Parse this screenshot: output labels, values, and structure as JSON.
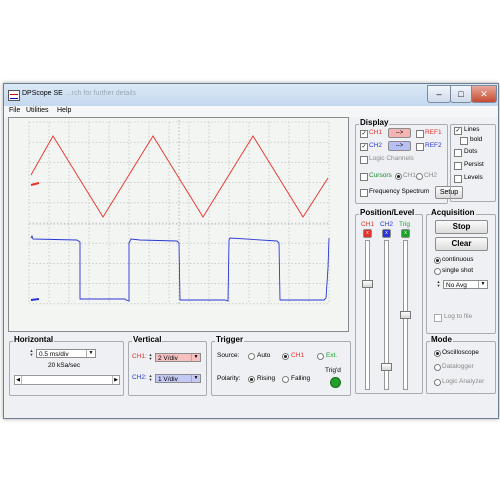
{
  "window": {
    "title": "DPScope SE",
    "behind_title": "...rch for further details"
  },
  "caption": {
    "minimize": "–",
    "maximize": "□",
    "close": "✕"
  },
  "menu": {
    "file": "File",
    "utilities": "Utilities",
    "help": "Help"
  },
  "display": {
    "title": "Display",
    "ch1": "CH1",
    "ch2": "CH2",
    "ref1": "REF1",
    "ref2": "REF2",
    "logic_channels": "Logic Channels",
    "cursors": "Cursors",
    "cursor_ch1": "CH1",
    "cursor_ch2": "CH2",
    "frequency_spectrum": "Frequency Spectrum",
    "setup": "Setup",
    "lines": "Lines",
    "bold": "bold",
    "dots": "Dots",
    "persist": "Persist",
    "levels": "Levels",
    "arrow": "-->"
  },
  "position_level": {
    "title": "Position/Level",
    "ch1": "CH1",
    "ch2": "CH2",
    "trig": "Trig",
    "btn_mark": "x"
  },
  "acquisition": {
    "title": "Acquisition",
    "stop": "Stop",
    "clear": "Clear",
    "continuous": "continuous",
    "single_shot": "single shot",
    "averaging": "No Avg",
    "log_to_file": "Log to file"
  },
  "mode": {
    "title": "Mode",
    "oscilloscope": "Oscilloscope",
    "datalogger": "Datalogger",
    "logic_analyzer": "Logic Analyzer"
  },
  "horizontal": {
    "title": "Horizontal",
    "timebase": "0.5 ms/div",
    "sample_rate": "20 kSa/sec"
  },
  "vertical": {
    "title": "Vertical",
    "ch1_label": "CH1:",
    "ch1_value": "2 V/div",
    "ch2_label": "CH2:",
    "ch2_value": "1 V/div"
  },
  "trigger": {
    "title": "Trigger",
    "source": "Source:",
    "auto": "Auto",
    "ch1": "CH1",
    "ext": "Ext.",
    "polarity": "Polarity:",
    "rising": "Rising",
    "falling": "Falling",
    "trigd": "Trig'd"
  },
  "colors": {
    "ch1": "#e8302a",
    "ch2": "#2a37d6",
    "trig": "#1aa32a",
    "trig_led": "#22a02a"
  },
  "icons": {
    "spin": "spin-arrows-icon",
    "dropdown": "chevron-down-icon",
    "app": "dpscope-app-icon"
  }
}
